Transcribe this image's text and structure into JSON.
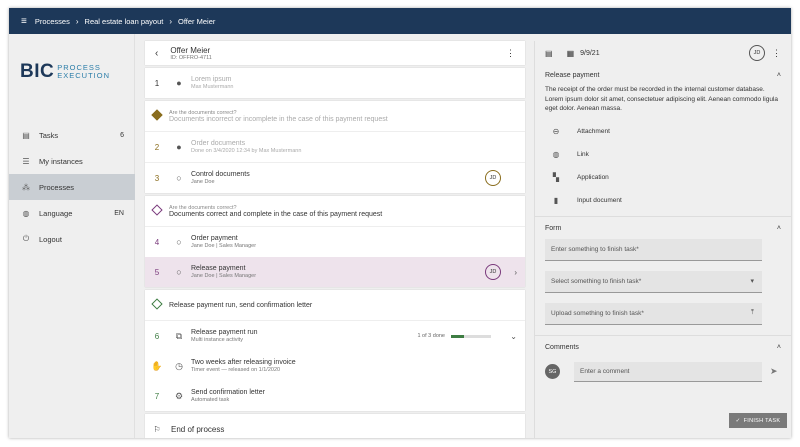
{
  "breadcrumb": [
    "Processes",
    "Real estate loan payout",
    "Offer Meier"
  ],
  "logo": {
    "main": "BIC",
    "line1": "PROCESS",
    "line2": "EXECUTION"
  },
  "sidebar": {
    "items": [
      {
        "label": "Tasks",
        "count": "6",
        "icon": "clipboard-icon"
      },
      {
        "label": "My instances",
        "count": "",
        "icon": "list-icon"
      },
      {
        "label": "Processes",
        "count": "",
        "icon": "hierarchy-icon"
      },
      {
        "label": "Language",
        "count": "EN",
        "icon": "globe-icon"
      },
      {
        "label": "Logout",
        "count": "",
        "icon": "power-icon"
      }
    ]
  },
  "process": {
    "title": "Offer Meier",
    "id": "ID: OFFRO-4711",
    "steps": {
      "s1": {
        "num": "1",
        "main": "Lorem ipsum",
        "sub": "Max Mustermann"
      },
      "g1": {
        "q": "Are the documents correct?",
        "a": "Documents incorrect or incomplete in the case of this payment request"
      },
      "s2": {
        "num": "2",
        "main": "Order documents",
        "sub": "Done on 3/4/2020 12:34 by Max Mustermann"
      },
      "s3": {
        "num": "3",
        "main": "Control documents",
        "sub": "Jane Doe",
        "avatar": "JD"
      },
      "g2": {
        "q": "Are the documents correct?",
        "a": "Documents correct and complete in the case of this payment request"
      },
      "s4": {
        "num": "4",
        "main": "Order payment",
        "sub": "Jane Doe | Sales Manager"
      },
      "s5": {
        "num": "5",
        "main": "Release payment",
        "sub": "Jane Doe | Sales Manager",
        "avatar": "JD"
      },
      "g3": {
        "a": "Release payment run, send confirmation letter"
      },
      "s6": {
        "num": "6",
        "main": "Release payment run",
        "sub": "Multi instance activity",
        "progress_text": "1 of 3 done",
        "progress": 0.33
      },
      "s6b": {
        "main": "Two weeks after releasing invoice",
        "sub": "Timer event — released on 1/1/2020"
      },
      "s7": {
        "num": "7",
        "main": "Send confirmation letter",
        "sub": "Automated task"
      },
      "end": {
        "main": "End of process"
      }
    }
  },
  "detail": {
    "date": "9/9/21",
    "avatar": "JD",
    "section_title": "Release payment",
    "description": "The receipt of the order must be recorded in the internal customer database. Lorem ipsum dolor sit amet, consectetuer adipiscing elit. Aenean commodo ligula eget dolor. Aenean massa.",
    "attachments": [
      {
        "label": "Attachment",
        "icon": "attachment-icon"
      },
      {
        "label": "Link",
        "icon": "globe-icon"
      },
      {
        "label": "Application",
        "icon": "apps-icon"
      },
      {
        "label": "Input document",
        "icon": "document-icon"
      }
    ],
    "form": {
      "title": "Form",
      "input1": "Enter something to finish task*",
      "select": "Select something to finish task*",
      "upload": "Upload something to finish task*"
    },
    "comments": {
      "title": "Comments",
      "avatar": "SG",
      "placeholder": "Enter a comment"
    },
    "finish_label": "FINISH TASK"
  }
}
